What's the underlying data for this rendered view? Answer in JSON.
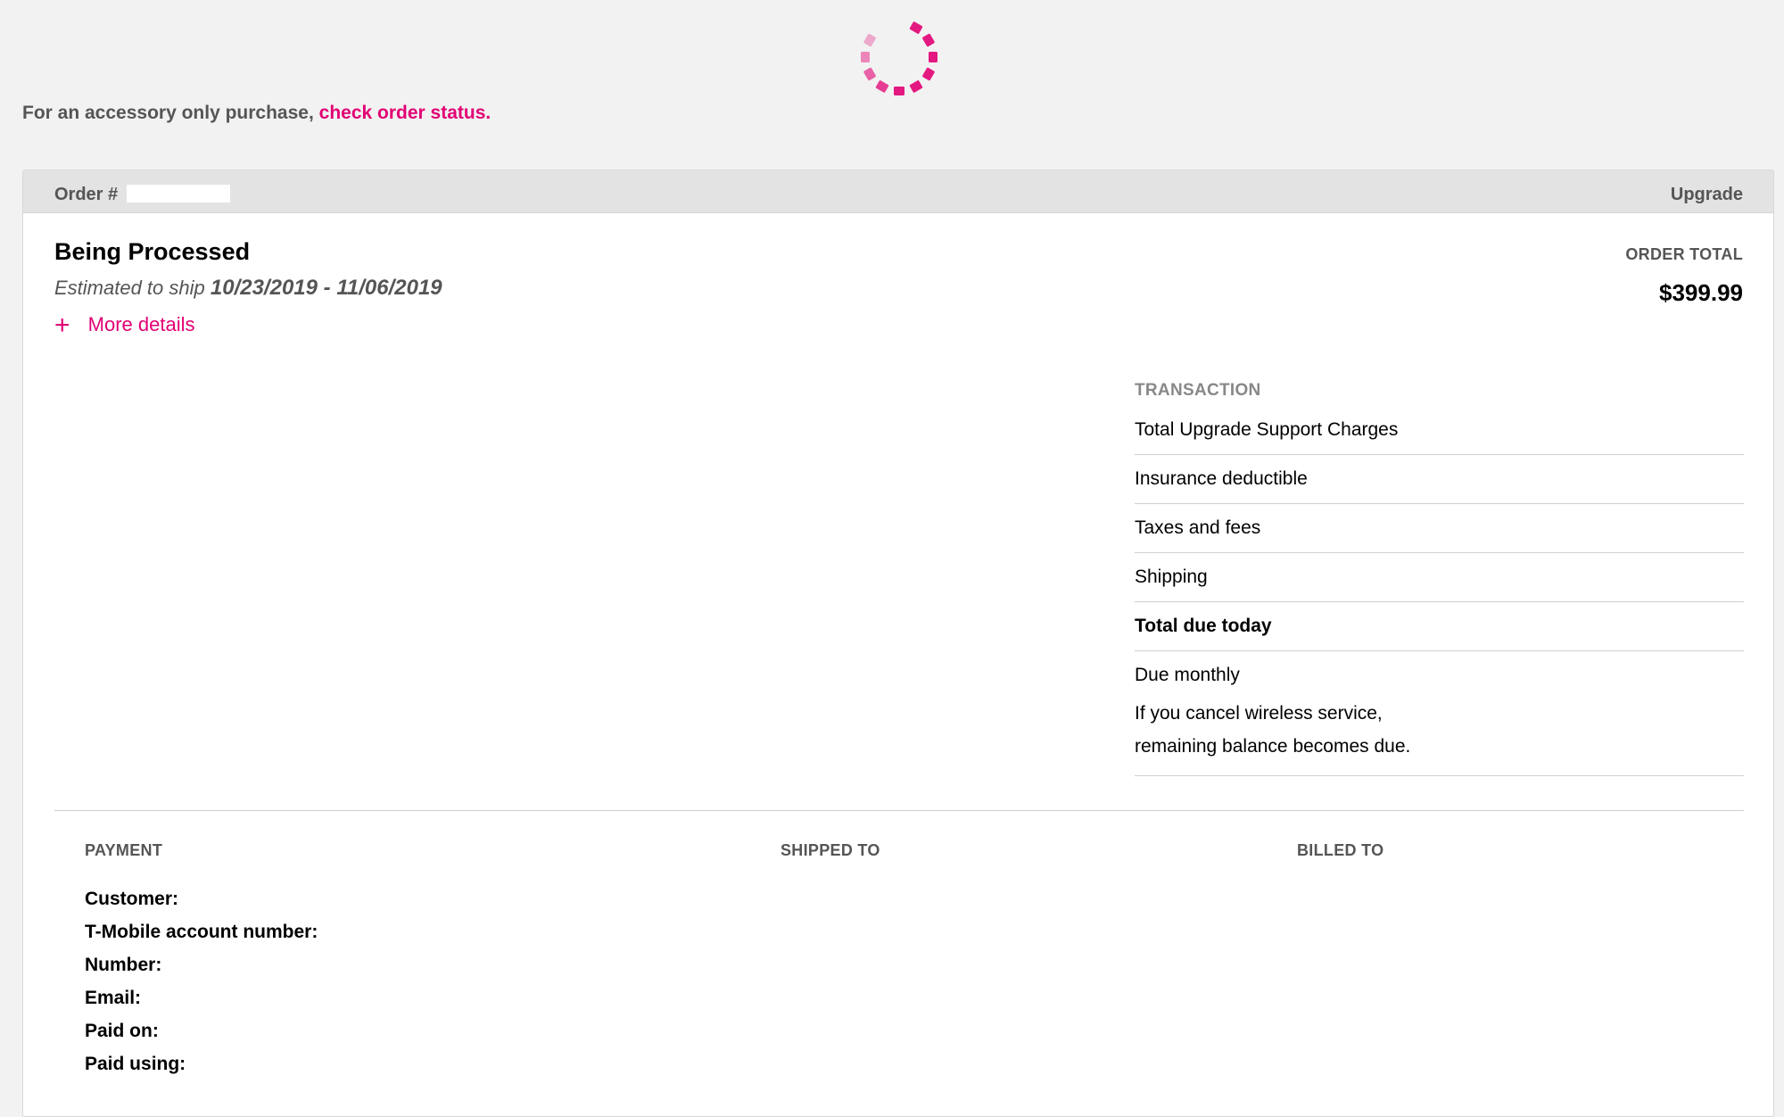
{
  "spinner": {
    "icon": "loading-spinner-icon",
    "color": "#e20074"
  },
  "accessory": {
    "prefix": "For an accessory only purchase,",
    "link": "check order status."
  },
  "order": {
    "number_label": "Order #",
    "type": "Upgrade",
    "status": "Being Processed",
    "ship_prefix": "Estimated to ship",
    "ship_dates": "10/23/2019 - 11/06/2019",
    "more_details": "More details",
    "more_details_icon": "plus-icon",
    "total_label": "ORDER TOTAL",
    "total_value": "$399.99"
  },
  "transaction": {
    "title": "TRANSACTION",
    "rows": [
      "Total Upgrade Support Charges",
      "Insurance deductible",
      "Taxes and fees",
      "Shipping",
      "Total due today",
      "Due monthly"
    ],
    "due_monthly_note_1": "If you cancel wireless service,",
    "due_monthly_note_2": "remaining balance becomes due."
  },
  "details": {
    "payment_title": "PAYMENT",
    "shipped_title": "SHIPPED TO",
    "billed_title": "BILLED TO",
    "payment_fields": [
      "Customer:",
      "T-Mobile account number:",
      "Number:",
      "Email:",
      "Paid on:",
      "Paid using:"
    ]
  },
  "colors": {
    "brand": "#e20074",
    "background": "#f2f2f2",
    "header": "#e3e3e3"
  }
}
